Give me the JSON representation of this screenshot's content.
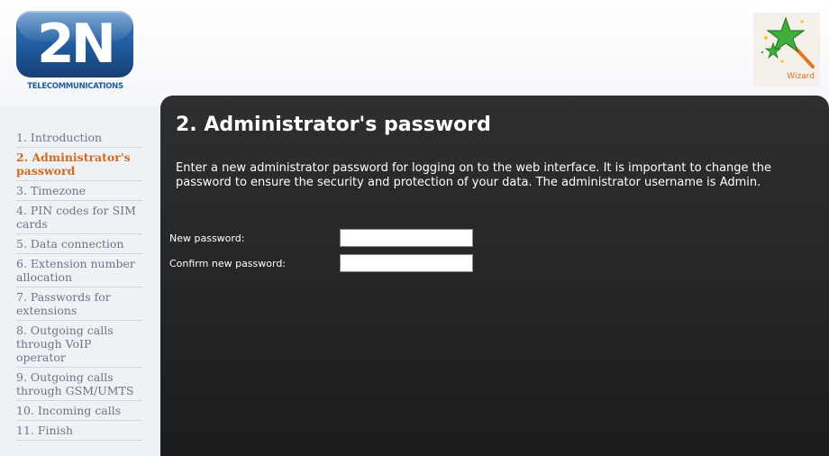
{
  "brand": {
    "logo_text": "2N",
    "logo_subtitle": "TELECOMMUNICATIONS"
  },
  "wizard": {
    "label": "Wizard",
    "icon": "magic-wand-icon"
  },
  "sidebar": {
    "items": [
      {
        "label": "1. Introduction"
      },
      {
        "label": "2. Administrator's password"
      },
      {
        "label": "3. Timezone"
      },
      {
        "label": "4. PIN codes for SIM cards"
      },
      {
        "label": "5. Data connection"
      },
      {
        "label": "6. Extension number allocation"
      },
      {
        "label": "7. Passwords for extensions"
      },
      {
        "label": "8. Outgoing calls through VoIP operator"
      },
      {
        "label": "9. Outgoing calls through GSM/UMTS"
      },
      {
        "label": "10. Incoming calls"
      },
      {
        "label": "11. Finish"
      }
    ],
    "active_index": 1
  },
  "main": {
    "title": "2. Administrator's password",
    "description": "Enter a new administrator password for logging on to the web interface. It is important to change the password to ensure the security and protection of your data. The administrator username is Admin.",
    "fields": [
      {
        "label": "New password:",
        "value": ""
      },
      {
        "label": "Confirm new password:",
        "value": ""
      }
    ]
  },
  "colors": {
    "accent": "#d46a1c",
    "panel_bg": "#222426",
    "sidebar_bg": "#eef1f5",
    "logo_blue": "#1f5a9c"
  }
}
